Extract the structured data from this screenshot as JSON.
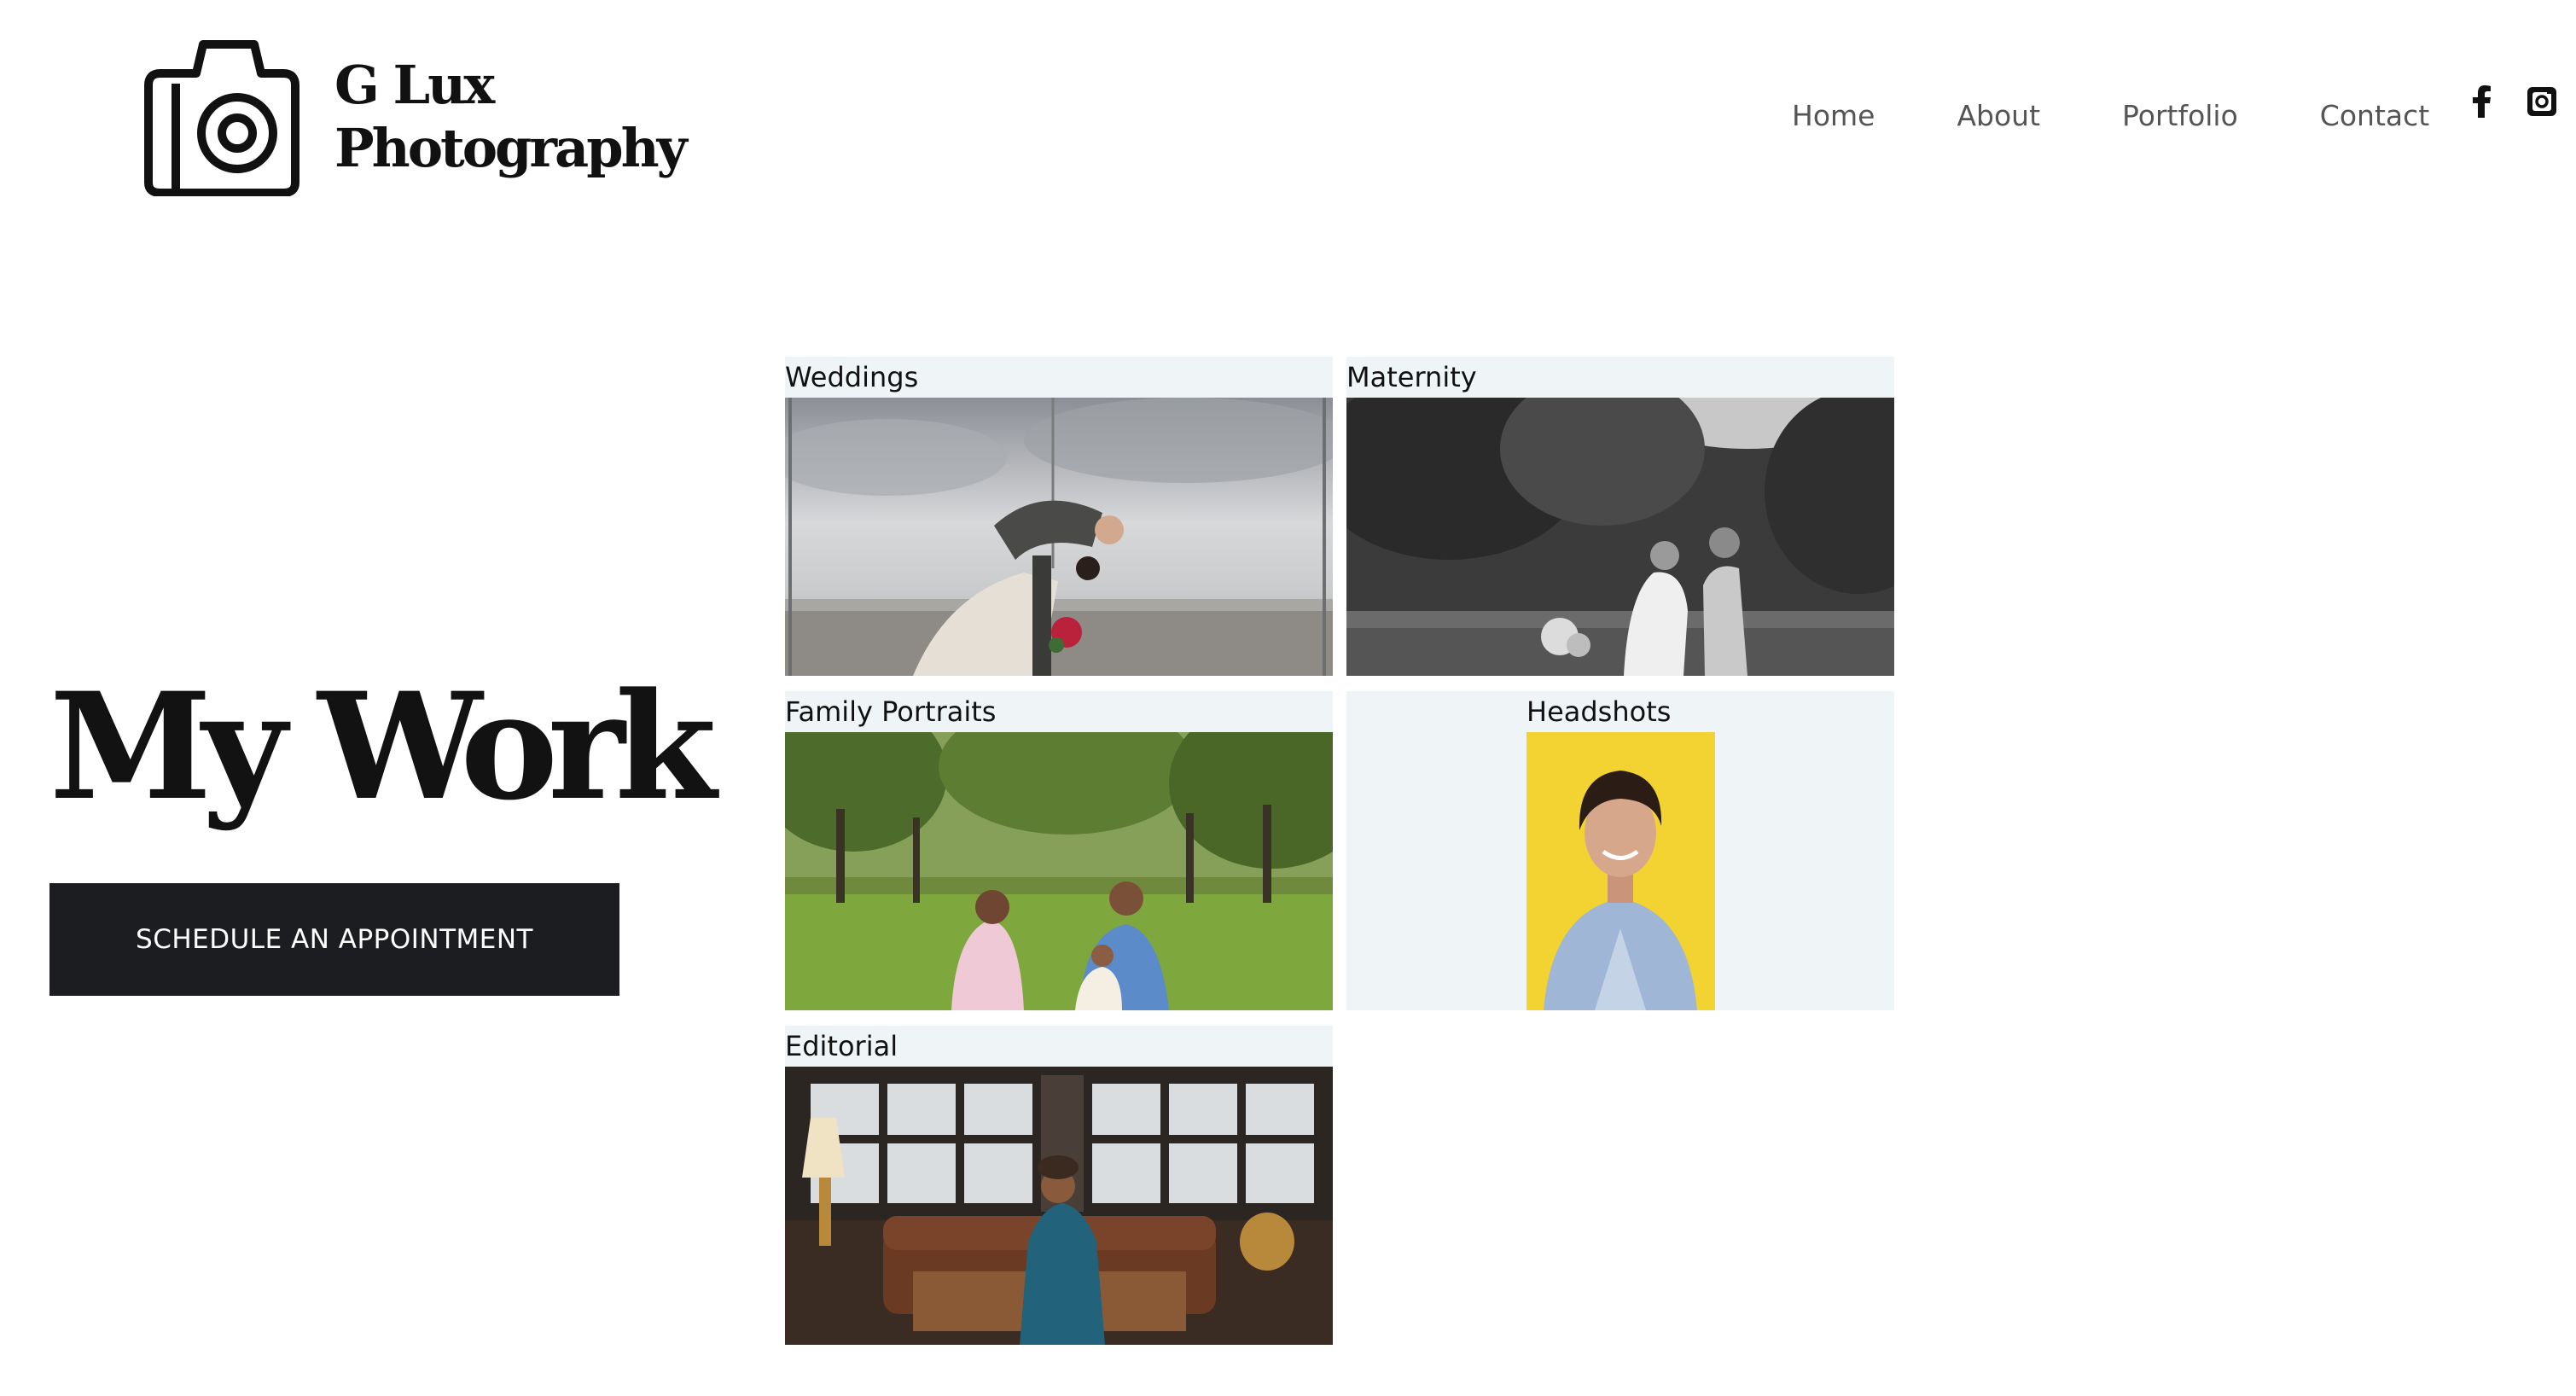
{
  "header": {
    "logo_line1": "G Lux",
    "logo_line2": "Photography",
    "logo_icon": "camera-icon",
    "nav": [
      {
        "label": "Home"
      },
      {
        "label": "About"
      },
      {
        "label": "Portfolio"
      },
      {
        "label": "Contact"
      }
    ],
    "social": [
      {
        "icon": "facebook-icon"
      },
      {
        "icon": "instagram-icon"
      }
    ]
  },
  "hero": {
    "title": "My Work",
    "cta_label": "SCHEDULE AN APPOINTMENT"
  },
  "gallery": {
    "items": [
      {
        "label": "Weddings"
      },
      {
        "label": "Maternity"
      },
      {
        "label": "Family Portraits"
      },
      {
        "label": "Headshots"
      },
      {
        "label": "Editorial"
      }
    ]
  },
  "colors": {
    "text": "#111111",
    "nav_text": "#555555",
    "cta_bg": "#1b1d20",
    "cta_text": "#ffffff",
    "tile_bg": "#eff5f7"
  }
}
